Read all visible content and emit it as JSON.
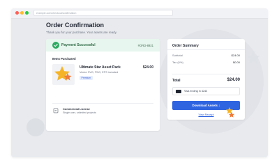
{
  "browser": {
    "url": "example.com/checkout/confirmation"
  },
  "page": {
    "title": "Order Confirmation",
    "subtitle": "Thank you for your purchase. Your assets are ready."
  },
  "status": {
    "label": "Payment Successful",
    "order_id": "#ORD-8921"
  },
  "items": {
    "heading": "Items Purchased",
    "list": [
      {
        "name": "Ultimate Star Asset Pack",
        "description": "Vector SVG, PNG, EPS included",
        "badge": "Premium",
        "price": "$24.00"
      }
    ]
  },
  "license": {
    "title": "Commercial License",
    "description": "Single user, unlimited projects"
  },
  "summary": {
    "heading": "Order Summary",
    "rows": [
      {
        "label": "Subtotal",
        "value": "$24.00"
      },
      {
        "label": "Tax (0%)",
        "value": "$0.00"
      }
    ],
    "total_label": "Total",
    "total_value": "$24.00",
    "payment_method": "Visa ending in 4242",
    "download_label": "Download Assets",
    "receipt_label": "View Receipt"
  },
  "colors": {
    "success_bg": "#e7f6ee",
    "success_accent": "#2eaa62",
    "primary": "#2f64e0",
    "star_gold": "#f5b428",
    "star_orange": "#f07a3a"
  },
  "icons": {
    "status": "check-circle-icon",
    "license": "document-icon",
    "payment": "credit-card-icon",
    "download": "arrow-down-icon"
  }
}
